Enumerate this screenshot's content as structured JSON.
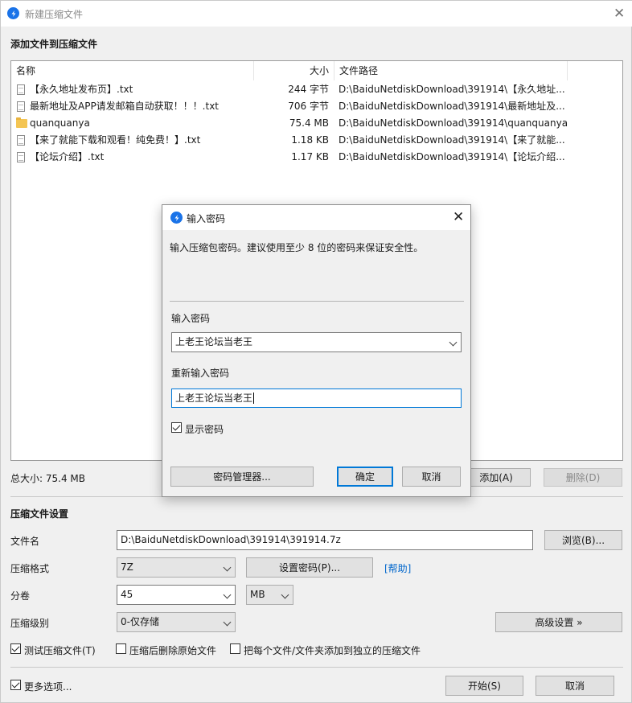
{
  "window": {
    "title": "新建压缩文件"
  },
  "add_section": {
    "title": "添加文件到压缩文件"
  },
  "file_list": {
    "columns": [
      "名称",
      "大小",
      "文件路径"
    ],
    "rows": [
      {
        "name": "【永久地址发布页】.txt",
        "size": "244 字节",
        "path": "D:\\BaiduNetdiskDownload\\391914\\【永久地址...",
        "icon": "text-file-icon"
      },
      {
        "name": "最新地址及APP请发邮箱自动获取！！！.txt",
        "size": "706 字节",
        "path": "D:\\BaiduNetdiskDownload\\391914\\最新地址及...",
        "icon": "text-file-icon"
      },
      {
        "name": "quanquanya",
        "size": "75.4 MB",
        "path": "D:\\BaiduNetdiskDownload\\391914\\quanquanya",
        "icon": "folder-icon"
      },
      {
        "name": "【来了就能下载和观看！纯免费！】.txt",
        "size": "1.18 KB",
        "path": "D:\\BaiduNetdiskDownload\\391914\\【来了就能...",
        "icon": "text-file-icon"
      },
      {
        "name": "【论坛介绍】.txt",
        "size": "1.17 KB",
        "path": "D:\\BaiduNetdiskDownload\\391914\\【论坛介绍...",
        "icon": "text-file-icon"
      }
    ]
  },
  "summary": {
    "total_size": "总大小: 75.4 MB"
  },
  "list_buttons": {
    "add": "添加(A)",
    "delete": "删除(D)"
  },
  "settings": {
    "title": "压缩文件设置",
    "filename_label": "文件名",
    "filename_value": "D:\\BaiduNetdiskDownload\\391914\\391914.7z",
    "browse": "浏览(B)...",
    "format_label": "压缩格式",
    "format_value": "7Z",
    "set_password": "设置密码(P)...",
    "help": "[帮助]",
    "volume_label": "分卷",
    "volume_value": "45",
    "volume_unit": "MB",
    "level_label": "压缩级别",
    "level_value": "0-仅存储",
    "advanced": "高级设置 »",
    "options": [
      {
        "label": "测试压缩文件(T)",
        "checked": true
      },
      {
        "label": "压缩后删除原始文件",
        "checked": false
      },
      {
        "label": "把每个文件/文件夹添加到独立的压缩文件",
        "checked": false
      }
    ],
    "more_options": {
      "label": "更多选项...",
      "checked": true
    },
    "start": "开始(S)",
    "cancel": "取消"
  },
  "password_dialog": {
    "title": "输入密码",
    "description": "输入压缩包密码。建议使用至少 8 位的密码来保证安全性。",
    "password_label": "输入密码",
    "password_value": "上老王论坛当老王",
    "confirm_label": "重新输入密码",
    "confirm_value": "上老王论坛当老王",
    "show_password": {
      "label": "显示密码",
      "checked": true
    },
    "manager": "密码管理器...",
    "ok": "确定",
    "cancel": "取消"
  },
  "colors": {
    "accent": "#0078d7",
    "link": "#0066cc",
    "folder": "#f4c553",
    "app_icon": "#1a73e8"
  }
}
